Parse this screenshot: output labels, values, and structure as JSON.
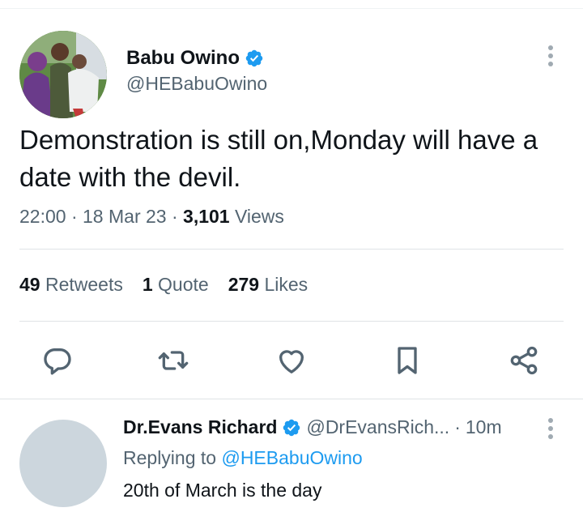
{
  "tweet": {
    "author": {
      "name": "Babu Owino",
      "handle": "@HEBabuOwino",
      "verified": true
    },
    "text": "Demonstration is still on,Monday will have a date with the devil.",
    "time": "22:00",
    "date": "18 Mar 23",
    "views_count": "3,101",
    "views_label": "Views",
    "stats": {
      "retweets_count": "49",
      "retweets_label": "Retweets",
      "quotes_count": "1",
      "quotes_label": "Quote",
      "likes_count": "279",
      "likes_label": "Likes"
    },
    "actions": [
      "reply-icon",
      "retweet-icon",
      "like-icon",
      "bookmark-icon",
      "share-icon"
    ]
  },
  "reply": {
    "author": {
      "name": "Dr.Evans Richard",
      "handle": "@DrEvansRich...",
      "verified": true
    },
    "time": "10m",
    "replying_label": "Replying to",
    "replying_to": "@HEBabuOwino",
    "text": "20th of March is the day"
  },
  "colors": {
    "accent": "#1d9bf0",
    "secondary_text": "#536471",
    "primary_text": "#0f1419",
    "icon": "#536471",
    "placeholder_avatar": "#ccd6dd"
  }
}
